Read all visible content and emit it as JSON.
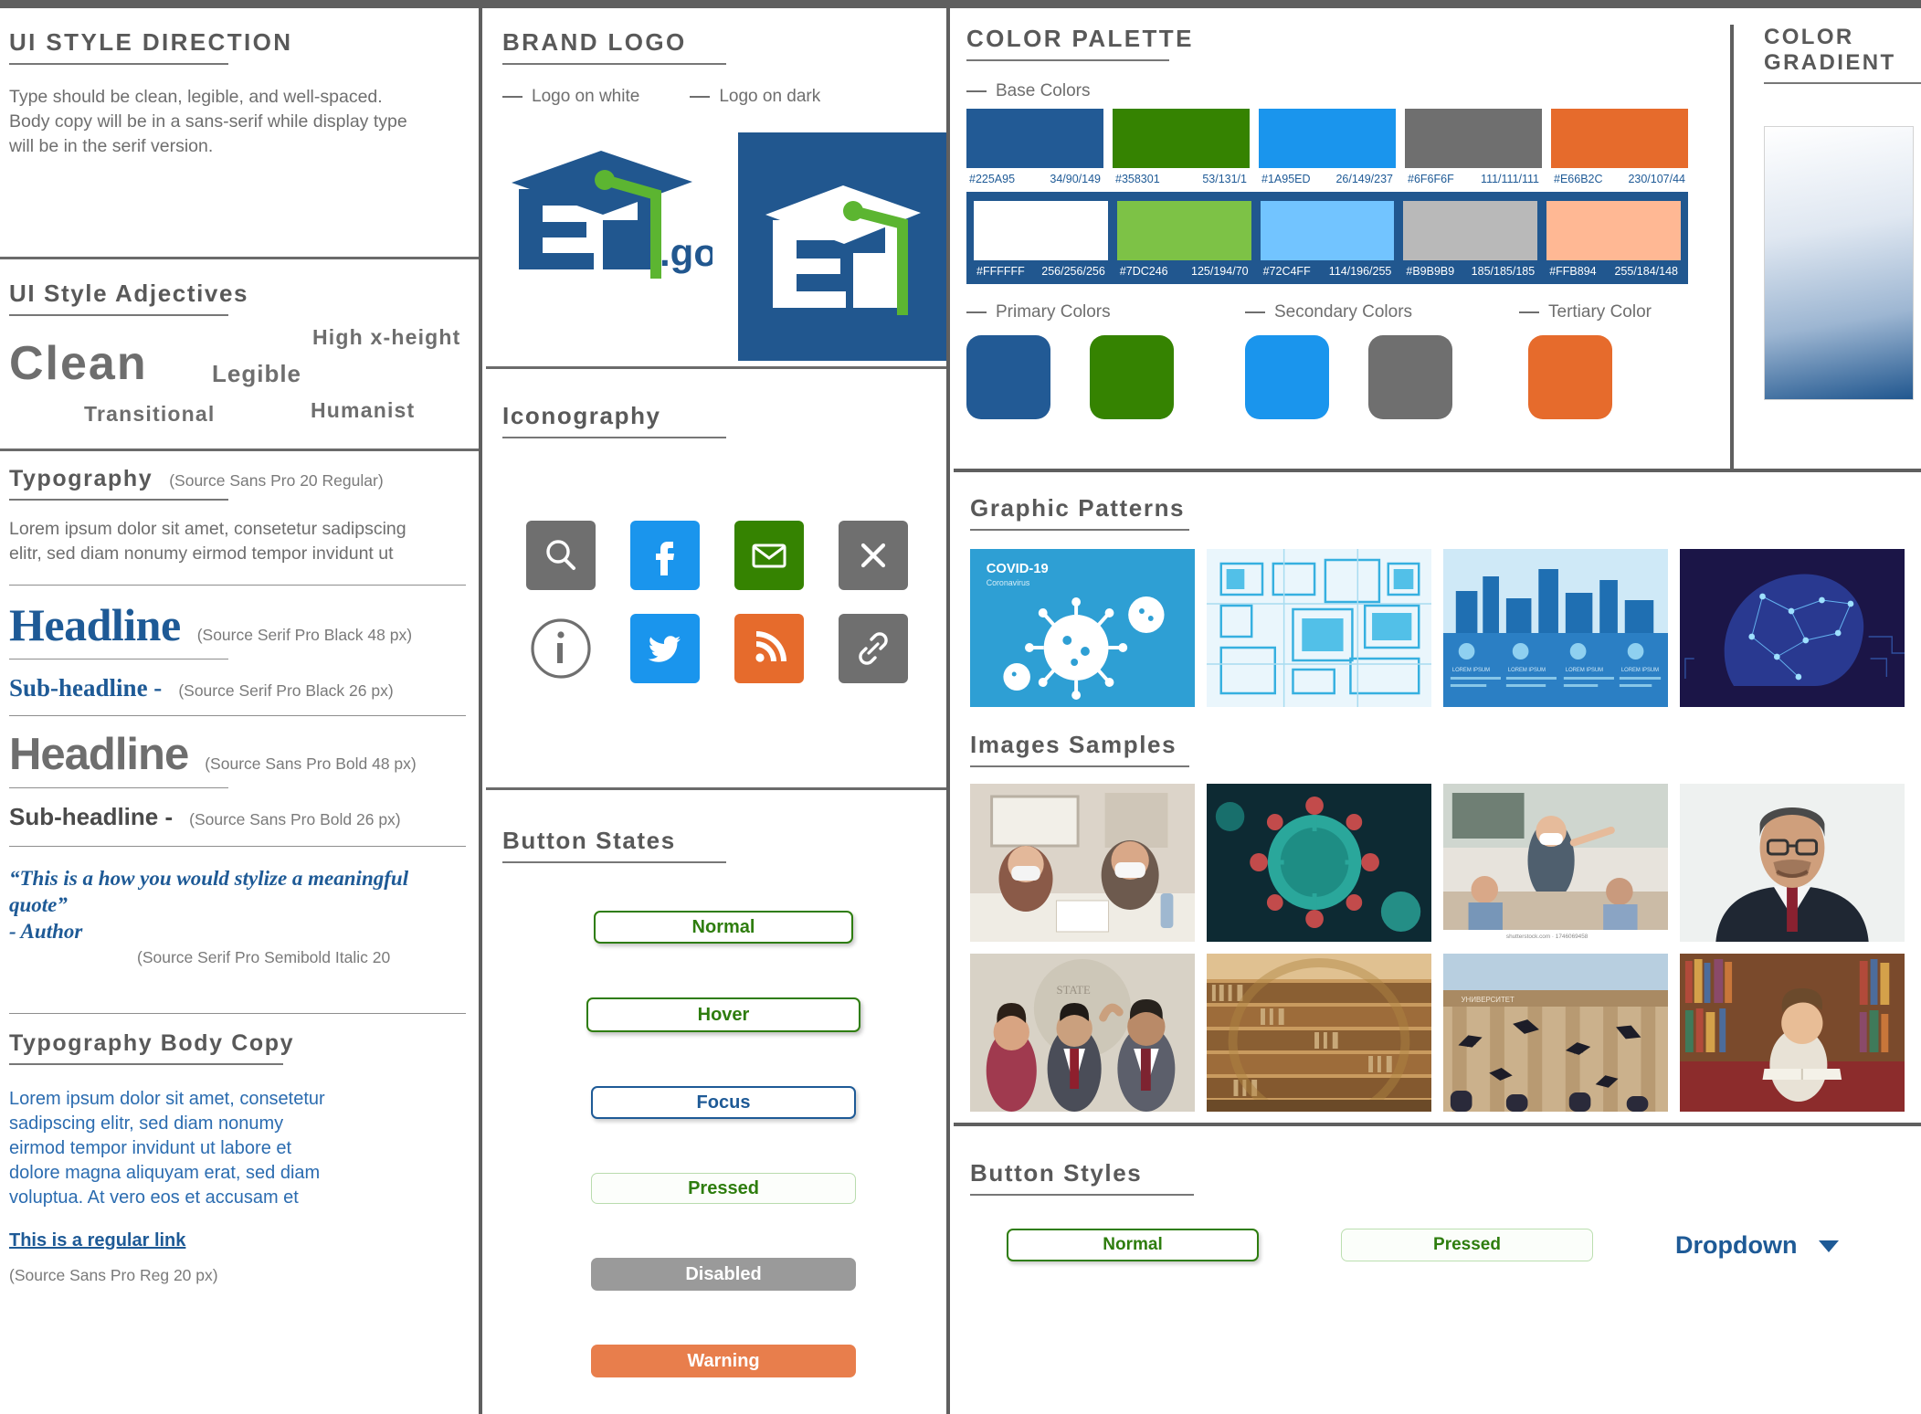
{
  "left": {
    "style_direction": {
      "title": "UI STYLE DIRECTION",
      "body": "Type should be clean, legible, and well-spaced. Body copy will be in a sans-serif while display type will be in the serif version."
    },
    "adjectives": {
      "title": "UI Style Adjectives",
      "words": [
        "Clean",
        "Legible",
        "High x-height",
        "Transitional",
        "Humanist"
      ]
    },
    "typography": {
      "title": "Typography",
      "spec": "(Source Sans Pro 20 Regular)",
      "sample": "Lorem ipsum dolor sit amet, consetetur sadipscing elitr, sed diam nonumy eirmod tempor invidunt ut",
      "rows": [
        {
          "label": "Headline",
          "spec": "(Source Serif Pro Black 48 px)"
        },
        {
          "label": "Sub-headline -",
          "spec": "(Source Serif Pro Black 26 px)"
        },
        {
          "label": "Headline",
          "spec": "(Source Sans Pro Bold 48 px)"
        },
        {
          "label": "Sub-headline -",
          "spec": "(Source Sans Pro Bold 26 px)"
        }
      ],
      "quote": "“This is a how you would stylize a meaningful quote”",
      "quote_author": " - Author",
      "quote_spec": "(Source Serif Pro Semibold Italic 20"
    },
    "body_copy": {
      "title": "Typography Body Copy",
      "text": "Lorem ipsum dolor sit amet, consetetur sadipscing elitr, sed diam nonumy eirmod tempor invidunt ut labore et dolore magna aliquyam erat, sed diam voluptua. At vero eos et accusam et",
      "link": "This is a regular link",
      "spec": "(Source Sans Pro Reg 20 px)"
    }
  },
  "middle": {
    "brand_logo": {
      "title": "BRAND LOGO",
      "legend_white": "Logo on white",
      "legend_dark": "Logo on dark",
      "wordmark": "Ed",
      "suffix": ".gov"
    },
    "iconography": {
      "title": "Iconography",
      "icons": [
        {
          "name": "search-icon",
          "bg": "#6f6f6f"
        },
        {
          "name": "facebook-icon",
          "bg": "#1a95ed"
        },
        {
          "name": "email-icon",
          "bg": "#358301"
        },
        {
          "name": "close-icon",
          "bg": "#6f6f6f"
        },
        {
          "name": "info-icon",
          "bg": "#ffffff"
        },
        {
          "name": "twitter-icon",
          "bg": "#1a95ed"
        },
        {
          "name": "rss-icon",
          "bg": "#e66b2c"
        },
        {
          "name": "link-icon",
          "bg": "#6f6f6f"
        }
      ]
    },
    "button_states": {
      "title": "Button States",
      "buttons": [
        {
          "label": "Normal",
          "state": "normal"
        },
        {
          "label": "Hover",
          "state": "hover"
        },
        {
          "label": "Focus",
          "state": "focus"
        },
        {
          "label": "Pressed",
          "state": "pressed"
        },
        {
          "label": "Disabled",
          "state": "disabled"
        },
        {
          "label": "Warning",
          "state": "warning"
        }
      ]
    }
  },
  "right": {
    "color_palette": {
      "title": "COLOR PALETTE",
      "base_label": "Base Colors",
      "base_colors": [
        {
          "hex": "#225A95",
          "rgb": "34/90/149",
          "swatch": "#225A95"
        },
        {
          "hex": "#358301",
          "rgb": "53/131/1",
          "swatch": "#358301"
        },
        {
          "hex": "#1A95ED",
          "rgb": "26/149/237",
          "swatch": "#1A95ED"
        },
        {
          "hex": "#6F6F6F",
          "rgb": "111/111/111",
          "swatch": "#6F6F6F"
        },
        {
          "hex": "#E66B2C",
          "rgb": "230/107/44",
          "swatch": "#E66B2C"
        }
      ],
      "tint_colors": [
        {
          "hex": "#FFFFFF",
          "rgb": "256/256/256",
          "swatch": "#FFFFFF"
        },
        {
          "hex": "#7DC246",
          "rgb": "125/194/70",
          "swatch": "#7DC246"
        },
        {
          "hex": "#72C4FF",
          "rgb": "114/196/255",
          "swatch": "#72C4FF"
        },
        {
          "hex": "#B9B9B9",
          "rgb": "185/185/185",
          "swatch": "#B9B9B9"
        },
        {
          "hex": "#FFB894",
          "rgb": "255/184/148",
          "swatch": "#FFB894"
        }
      ],
      "groups": [
        {
          "label": "Primary Colors",
          "colors": [
            "#225A95",
            "#358301"
          ]
        },
        {
          "label": "Secondary Colors",
          "colors": [
            "#1A95ED",
            "#6F6F6F"
          ]
        },
        {
          "label": "Tertiary Color",
          "colors": [
            "#E66B2C"
          ]
        }
      ]
    },
    "color_gradient": {
      "title": "COLOR GRADIENT"
    },
    "graphic_patterns": {
      "title": "Graphic Patterns",
      "items": [
        {
          "name": "covid-19-virus-pattern",
          "caption": "COVID-19",
          "subcaption": "Coronavirus"
        },
        {
          "name": "abstract-tech-squares-pattern",
          "caption": "",
          "subcaption": ""
        },
        {
          "name": "smart-city-infographic-pattern",
          "caption": "LOREM IPSUM",
          "subcaption": ""
        },
        {
          "name": "digital-brain-network-pattern",
          "caption": "",
          "subcaption": ""
        }
      ]
    },
    "image_samples": {
      "title": "Images Samples",
      "items": [
        {
          "name": "masked-meeting-photo",
          "caption": ""
        },
        {
          "name": "virus-microscopy-photo",
          "caption": ""
        },
        {
          "name": "masked-classroom-photo",
          "caption": "shutterstock.com · 1746069458"
        },
        {
          "name": "portrait-headshot-photo",
          "caption": ""
        },
        {
          "name": "oath-ceremony-photo",
          "caption": ""
        },
        {
          "name": "library-bookshelves-photo",
          "caption": ""
        },
        {
          "name": "graduation-caps-photo",
          "caption": ""
        },
        {
          "name": "child-reading-photo",
          "caption": ""
        }
      ]
    },
    "button_styles": {
      "title": "Button Styles",
      "normal": "Normal",
      "pressed": "Pressed",
      "dropdown": "Dropdown"
    }
  }
}
